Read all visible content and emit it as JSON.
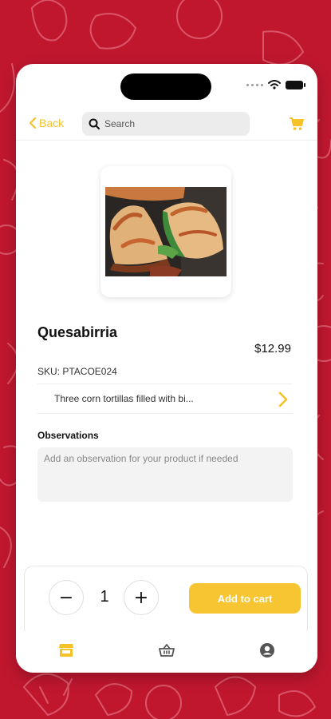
{
  "colors": {
    "accent": "#f5c227",
    "background_red": "#c0172f",
    "add_to_cart_bg": "#f7c531"
  },
  "header": {
    "back_label": "Back",
    "search_placeholder": "Search",
    "back_icon": "chevron-left-icon",
    "search_icon": "search-icon",
    "cart_icon": "shopping-cart-icon"
  },
  "product": {
    "name": "Quesabirria",
    "price": "$12.99",
    "sku": "SKU: PTACOE024",
    "description": "Three corn tortillas filled with bi..."
  },
  "observations": {
    "label": "Observations",
    "placeholder": "Add an observation for your product if needed"
  },
  "cart_controls": {
    "minus_label": "−",
    "quantity": "1",
    "plus_label": "+",
    "add_to_cart_label": "Add to cart"
  },
  "tab_bar": {
    "items": [
      {
        "icon": "store-icon",
        "active": true
      },
      {
        "icon": "basket-icon",
        "active": false
      },
      {
        "icon": "account-icon",
        "active": false
      }
    ]
  }
}
